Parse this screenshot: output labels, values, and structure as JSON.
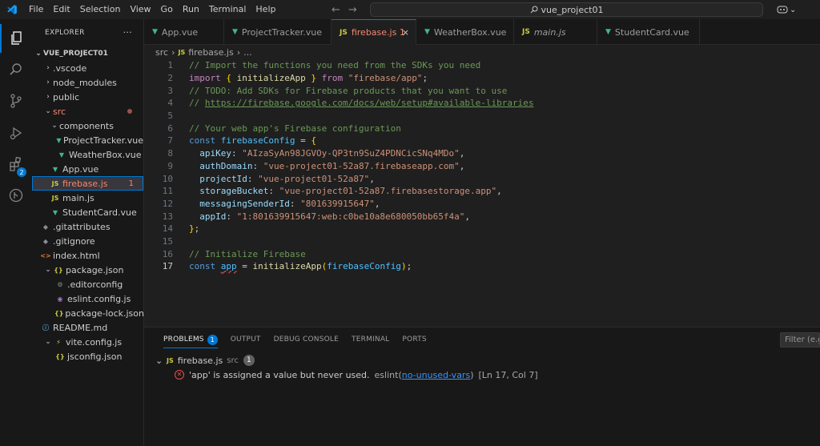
{
  "menu": [
    "File",
    "Edit",
    "Selection",
    "View",
    "Go",
    "Run",
    "Terminal",
    "Help"
  ],
  "search": {
    "text": "vue_project01"
  },
  "explorer": {
    "title": "EXPLORER",
    "more": "···",
    "root": "VUE_PROJECT01",
    "items": [
      {
        "label": ".vscode",
        "chev": "›",
        "icon": "",
        "color": ""
      },
      {
        "label": "node_modules",
        "chev": "›",
        "icon": "",
        "color": ""
      },
      {
        "label": "public",
        "chev": "›",
        "icon": "",
        "color": ""
      },
      {
        "label": "src",
        "chev": "⌄",
        "icon": "",
        "color": "c-red"
      },
      {
        "label": "components",
        "chev": "⌄",
        "icon": "",
        "color": ""
      },
      {
        "label": "ProjectTracker.vue",
        "chev": "",
        "icon": "▼",
        "color": ""
      },
      {
        "label": "WeatherBox.vue",
        "chev": "",
        "icon": "▼",
        "color": ""
      },
      {
        "label": "App.vue",
        "chev": "",
        "icon": "▼",
        "color": ""
      },
      {
        "label": "firebase.js",
        "chev": "",
        "icon": "JS",
        "color": "c-red",
        "extra": "1"
      },
      {
        "label": "main.js",
        "chev": "",
        "icon": "JS",
        "color": ""
      },
      {
        "label": "StudentCard.vue",
        "chev": "",
        "icon": "▼",
        "color": ""
      },
      {
        "label": ".gitattributes",
        "chev": "",
        "icon": "◆",
        "color": ""
      },
      {
        "label": ".gitignore",
        "chev": "",
        "icon": "◆",
        "color": ""
      },
      {
        "label": "index.html",
        "chev": "",
        "icon": "<>",
        "color": ""
      },
      {
        "label": "package.json",
        "chev": "⌄",
        "icon": "{}",
        "color": ""
      },
      {
        "label": ".editorconfig",
        "chev": "",
        "icon": "⚙",
        "color": ""
      },
      {
        "label": "eslint.config.js",
        "chev": "",
        "icon": "◉",
        "color": ""
      },
      {
        "label": "package-lock.json",
        "chev": "",
        "icon": "{}",
        "color": ""
      },
      {
        "label": "README.md",
        "chev": "",
        "icon": "ⓘ",
        "color": ""
      },
      {
        "label": "vite.config.js",
        "chev": "⌄",
        "icon": "⚡",
        "color": ""
      },
      {
        "label": "jsconfig.json",
        "chev": "",
        "icon": "{}",
        "color": ""
      }
    ]
  },
  "tabs": [
    {
      "label": "App.vue",
      "icon": "▼"
    },
    {
      "label": "ProjectTracker.vue",
      "icon": "▼"
    },
    {
      "label": "firebase.js 1",
      "icon": "JS",
      "close": "×"
    },
    {
      "label": "WeatherBox.vue",
      "icon": "▼"
    },
    {
      "label": "main.js",
      "icon": "JS"
    },
    {
      "label": "StudentCard.vue",
      "icon": "▼"
    }
  ],
  "breadcrumb": {
    "folder": "src",
    "sep1": "›",
    "icon": "JS",
    "file": "firebase.js",
    "sep2": "›",
    "tail": "..."
  },
  "editor": {
    "line_numbers": [
      "1",
      "2",
      "3",
      "4",
      "5",
      "6",
      "7",
      "8",
      "9",
      "10",
      "11",
      "12",
      "13",
      "14",
      "15",
      "16",
      "17"
    ],
    "current_line": "17"
  },
  "code": {
    "l1": "// Import the functions you need from the SDKs you need",
    "l2_import": "import",
    "l2_lb": "{",
    "l2_name": "initializeApp",
    "l2_rb": "}",
    "l2_from": "from",
    "l2_src": "\"firebase/app\"",
    "l2_semi": ";",
    "l3": "// TODO: Add SDKs for Firebase products that you want to use",
    "l4_prefix": "// ",
    "l4_url": "https://firebase.google.com/docs/web/setup#available-libraries",
    "l6": "// Your web app's Firebase configuration",
    "l7_const": "const",
    "l7_name": "firebaseConfig",
    "l7_eq": "=",
    "l7_brace": "{",
    "props": [
      {
        "key": "apiKey",
        "value": "\"AIzaSyAn98JGVOy-QP3tn9SuZ4PDNCicSNq4MDo\""
      },
      {
        "key": "authDomain",
        "value": "\"vue-project01-52a87.firebaseapp.com\""
      },
      {
        "key": "projectId",
        "value": "\"vue-project01-52a87\""
      },
      {
        "key": "storageBucket",
        "value": "\"vue-project01-52a87.firebasestorage.app\""
      },
      {
        "key": "messagingSenderId",
        "value": "\"801639915647\""
      },
      {
        "key": "appId",
        "value": "\"1:801639915647:web:c0be10a8e680050bb65f4a\""
      }
    ],
    "l14_brace": "}",
    "l16": "// Initialize Firebase",
    "l17_const": "const",
    "l17_name": "app",
    "l17_eq": "=",
    "l17_fn": "initializeApp",
    "l17_lp": "(",
    "l17_arg": "firebaseConfig",
    "l17_rp": ")",
    "l17_semi": ";"
  },
  "panel": {
    "tabs": [
      "PROBLEMS",
      "OUTPUT",
      "DEBUG CONSOLE",
      "TERMINAL",
      "PORTS"
    ],
    "problems_count": "1",
    "filter_placeholder": "Filter (e.g.",
    "file": {
      "icon": "JS",
      "name": "firebase.js",
      "dir": "src",
      "count": "1"
    },
    "error": {
      "message": "'app' is assigned a value but never used.",
      "source": "eslint",
      "rule": "no-unused-vars",
      "location": "[Ln 17, Col 7]"
    }
  },
  "colors": {
    "accent": "#0078d4",
    "error": "#f14c4c",
    "modified": "#f48771"
  }
}
